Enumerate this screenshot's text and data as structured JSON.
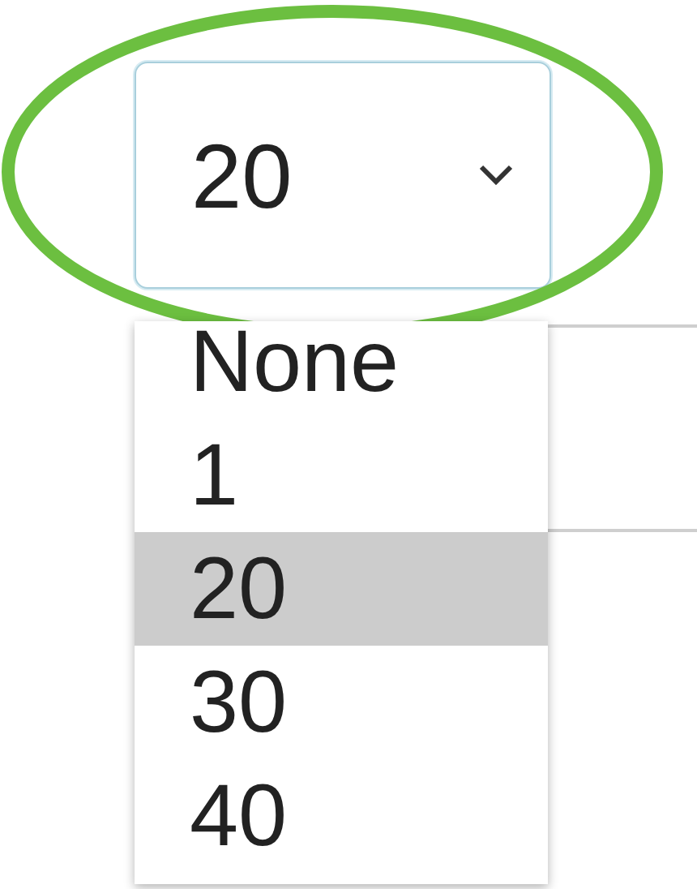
{
  "select": {
    "value": "20",
    "expanded": true
  },
  "options": [
    {
      "label": "None",
      "selected": false
    },
    {
      "label": "1",
      "selected": false
    },
    {
      "label": "20",
      "selected": true
    },
    {
      "label": "30",
      "selected": false
    },
    {
      "label": "40",
      "selected": false
    }
  ]
}
